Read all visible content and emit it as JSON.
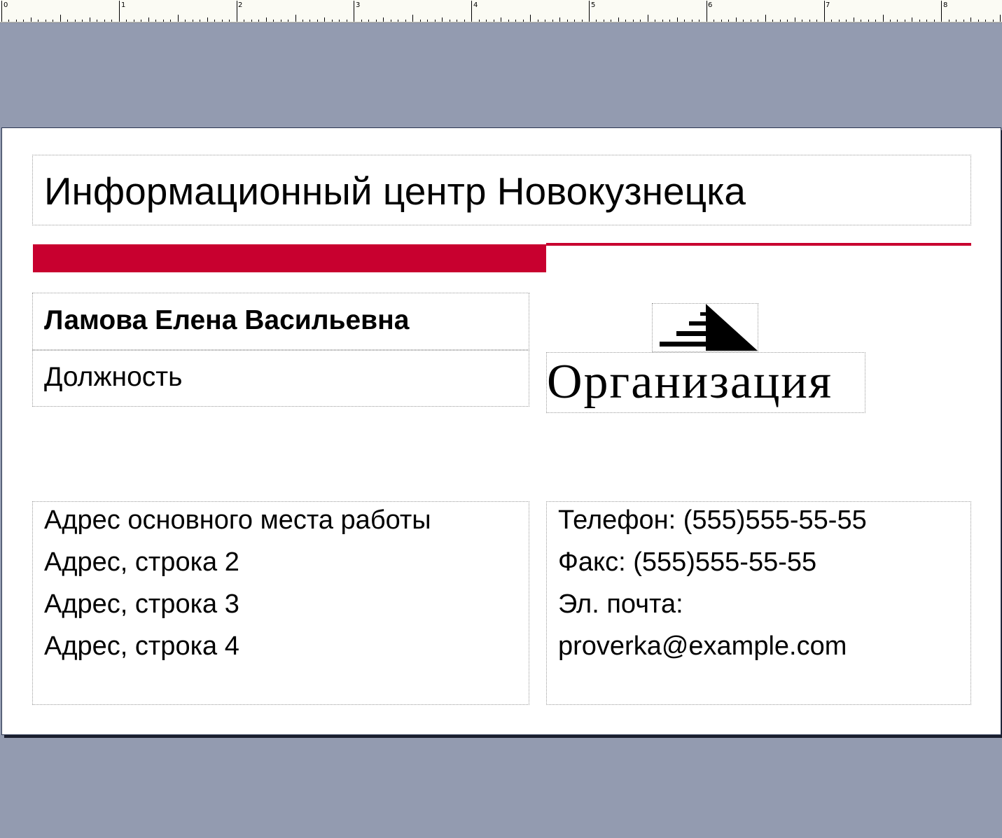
{
  "ruler": {
    "marks": [
      "0",
      "1",
      "2",
      "3",
      "4",
      "5",
      "6",
      "7",
      "8"
    ]
  },
  "card": {
    "company": "Информационный центр Новокузнецка",
    "name": "Ламова Елена Васильевна",
    "position": "Должность",
    "organization": "Организация",
    "address_lines": [
      "Адрес основного места работы",
      "Адрес, строка 2",
      "Адрес, строка 3",
      "Адрес, строка 4"
    ],
    "contact_lines": [
      "Телефон: (555)555-55-55",
      "Факс: (555)555-55-55",
      "Эл. почта:",
      "proverka@example.com"
    ]
  },
  "colors": {
    "accent": "#c8002f",
    "workspace": "#939bb0",
    "card": "#ffffff"
  },
  "icons": {
    "logo": "pyramid-logo-icon"
  }
}
